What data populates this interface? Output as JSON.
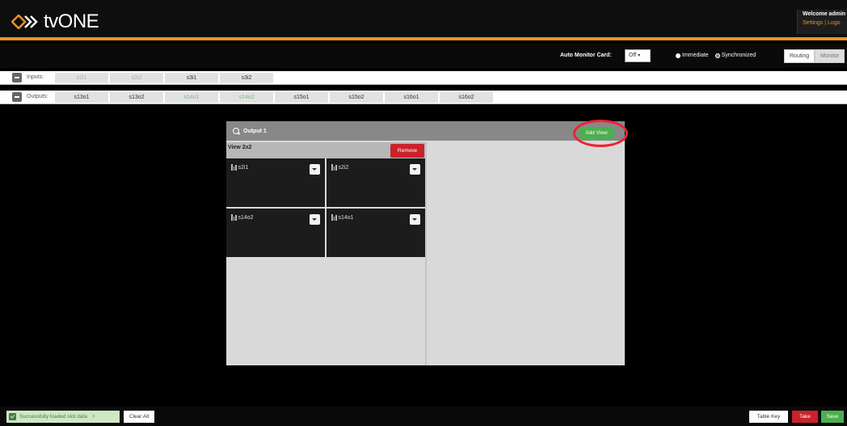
{
  "header": {
    "brand": "tvONE",
    "welcome": "Welcome admin",
    "settings_link": "Settings",
    "separator": "|",
    "logout_link": "Logo",
    "accent_color": "#e8922a"
  },
  "toolbar": {
    "auto_monitor_label": "Auto Monitor Card:",
    "auto_monitor_value": "Off",
    "radio_immediate": "Immediate",
    "radio_synchronized": "Synchronized",
    "mode_routing": "Routing",
    "mode_monitor": "Monitor"
  },
  "inputs": {
    "label": "Inputs:",
    "chips": [
      "s2i1",
      "s2i2",
      "s3i1",
      "s3i2"
    ]
  },
  "outputs": {
    "label": "Outputs:",
    "chips": [
      "s13o1",
      "s13o2",
      "s14o1",
      "s14o2",
      "s15o1",
      "s15o2",
      "s16o1",
      "s16o2"
    ]
  },
  "panel": {
    "title": "Output 1",
    "add_view_label": "Add View",
    "view_label": "View 2x2",
    "remove_label": "Remove",
    "cells": [
      "s2i1",
      "s2i2",
      "s14o2",
      "s14o1"
    ]
  },
  "footer": {
    "status_message": "Successfully loaded slot data",
    "close_x": "×",
    "clear_all": "Clear All",
    "table_key": "Table Key",
    "take": "Take",
    "save": "Save"
  }
}
